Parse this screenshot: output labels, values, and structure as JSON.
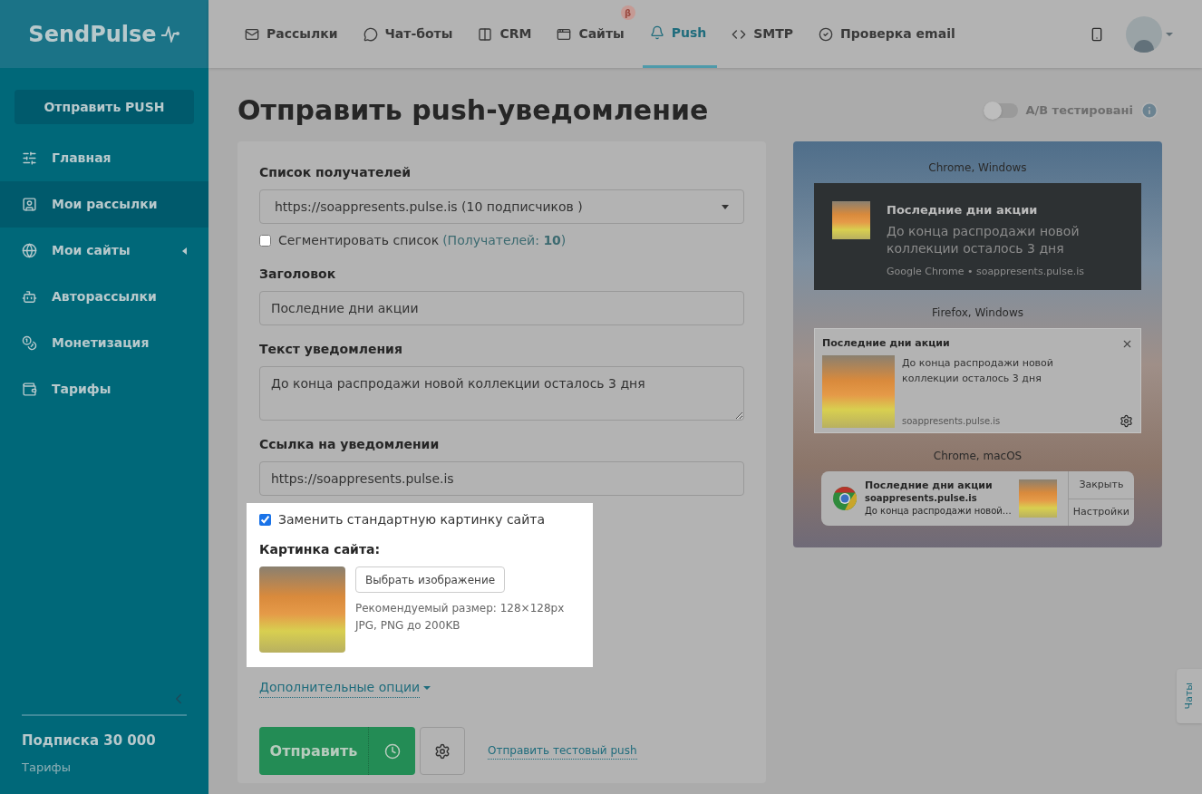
{
  "logo": "SendPulse",
  "nav": [
    {
      "label": "Рассылки",
      "kind": "mail",
      "selected": false
    },
    {
      "label": "Чат-боты",
      "kind": "bot",
      "selected": false
    },
    {
      "label": "CRM",
      "kind": "crm",
      "selected": false
    },
    {
      "label": "Сайты",
      "kind": "site",
      "selected": false,
      "badge": "β"
    },
    {
      "label": "Push",
      "kind": "bell",
      "selected": true
    },
    {
      "label": "SMTP",
      "kind": "code",
      "selected": false
    },
    {
      "label": "Проверка email",
      "kind": "check",
      "selected": false
    }
  ],
  "sidebar": {
    "send_button": "Отправить PUSH",
    "items": [
      {
        "label": "Главная",
        "kind": "sliders",
        "selected": false,
        "expandable": false
      },
      {
        "label": "Мои рассылки",
        "kind": "user",
        "selected": true,
        "expandable": false
      },
      {
        "label": "Мои сайты",
        "kind": "globe",
        "selected": false,
        "expandable": true
      },
      {
        "label": "Авторассылки",
        "kind": "auto",
        "selected": false,
        "expandable": false
      },
      {
        "label": "Монетизация",
        "kind": "money",
        "selected": false,
        "expandable": false
      },
      {
        "label": "Тарифы",
        "kind": "wallet",
        "selected": false,
        "expandable": false
      }
    ],
    "plan": "Подписка 30 000",
    "plan_link": "Тарифы"
  },
  "title": "Отправить push-уведомление",
  "ab_test": {
    "label": "A/B тестировані",
    "on": false
  },
  "form": {
    "recipients_label": "Список получателей",
    "recipients_value": "https://soappresents.pulse.is (10 подписчиков )",
    "segment": {
      "label": "Сегментировать список",
      "count": "(Получателей: **10**)",
      "checked": false
    },
    "title_label": "Заголовок",
    "title_value": "Последние дни акции",
    "text_label": "Текст уведомления",
    "text_value": "До конца распродажи новой коллекции осталось 3 дня",
    "link_label": "Ссылка на уведомлении",
    "link_value": "https://soappresents.pulse.is",
    "replace_image": {
      "label": "Заменить стандартную картинку сайта",
      "checked": true
    },
    "image_label": "Картинка сайта:",
    "choose_button": "Выбрать изображение",
    "hints": [
      "Рекомендуемый размер: 128×128px",
      "JPG, PNG до 200KB"
    ],
    "more_options": "Дополнительные опции",
    "send_button": "Отправить",
    "test_link": "Отправить тестовый push"
  },
  "preview": {
    "chrome_windows": {
      "caption": "Chrome, Windows",
      "title": "Последние дни акции",
      "body": "До конца распродажи новой коллекции осталось 3 дня",
      "source": "Google Chrome • soappresents.pulse.is"
    },
    "firefox_windows": {
      "caption": "Firefox, Windows",
      "title": "Последние дни акции",
      "body": "До конца распродажи новой коллекции осталось 3 дня",
      "source": "soappresents.pulse.is"
    },
    "chrome_macos": {
      "caption": "Chrome, macOS",
      "title": "Последние дни акции",
      "site": "soappresents.pulse.is",
      "body": "До конца распродажи новой…",
      "buttons": [
        "Закрыть",
        "Настройки"
      ]
    }
  },
  "chats_tab": "Чаты"
}
